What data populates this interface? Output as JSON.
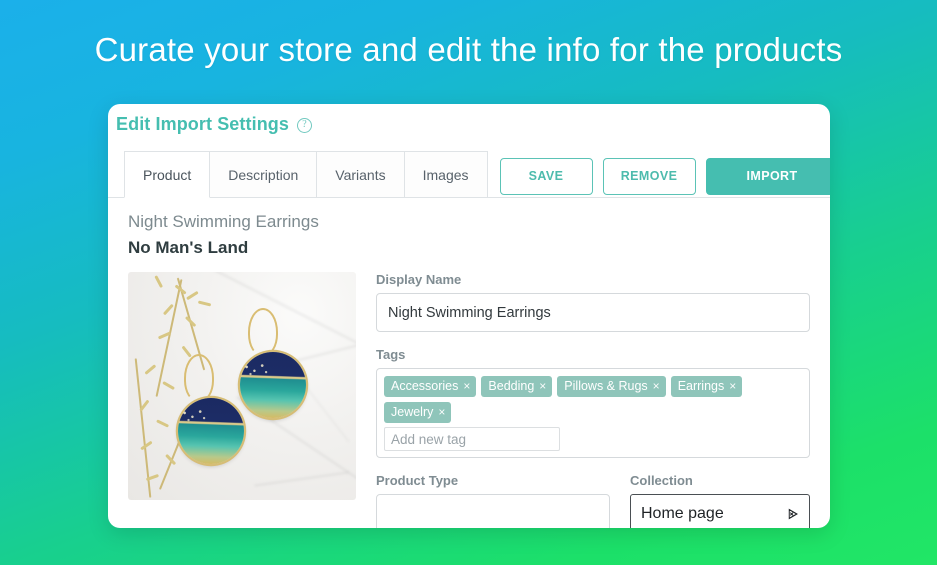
{
  "hero": {
    "title": "Curate your store and edit the info for the products"
  },
  "card": {
    "title": "Edit Import Settings",
    "help_icon": "question-circle-icon"
  },
  "tabs": [
    {
      "label": "Product",
      "active": true
    },
    {
      "label": "Description",
      "active": false
    },
    {
      "label": "Variants",
      "active": false
    },
    {
      "label": "Images",
      "active": false
    }
  ],
  "actions": {
    "save": "SAVE",
    "remove": "REMOVE",
    "import": "IMPORT"
  },
  "product": {
    "name": "Night Swimming Earrings",
    "vendor": "No Man's Land",
    "image_alt": "navy-and-teal-round-earrings-on-marble"
  },
  "fields": {
    "display_name": {
      "label": "Display Name",
      "value": "Night Swimming Earrings"
    },
    "tags": {
      "label": "Tags",
      "items": [
        "Accessories",
        "Bedding",
        "Pillows & Rugs",
        "Earrings",
        "Jewelry"
      ],
      "remove_glyph": "×",
      "add_placeholder": "Add new tag",
      "add_value": ""
    },
    "product_type": {
      "label": "Product Type",
      "value": "",
      "placeholder": ""
    },
    "collection": {
      "label": "Collection",
      "selected": "Home page",
      "options": [
        "Home page"
      ],
      "chevron": "⌄"
    }
  },
  "colors": {
    "accent_teal": "#45BEB0",
    "tag_bg": "#8FC5BA",
    "bg_top": "#1BB0EA",
    "bg_bottom": "#21E666",
    "label_gray": "#7f8c92"
  }
}
